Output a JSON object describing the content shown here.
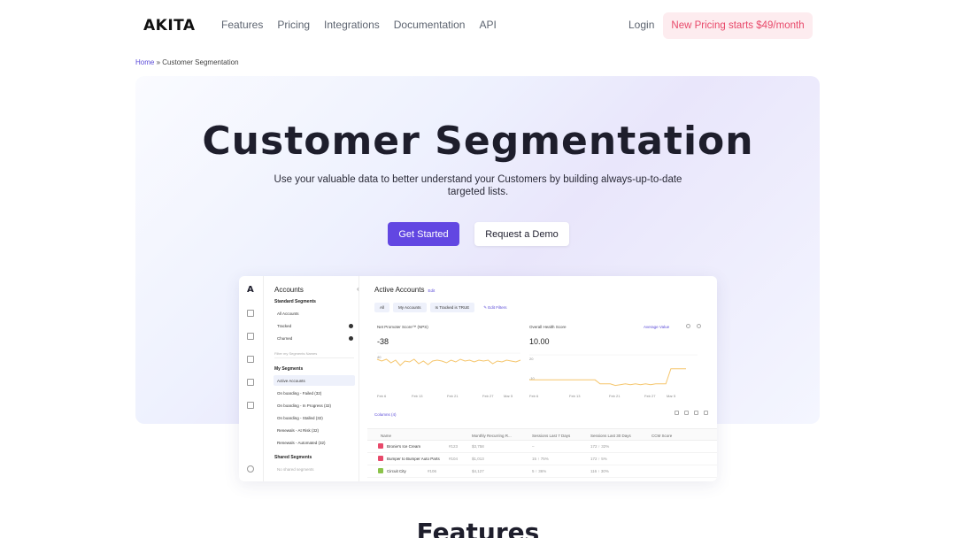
{
  "nav": {
    "logo": "AKITA",
    "links": [
      "Features",
      "Pricing",
      "Integrations",
      "Documentation",
      "API"
    ],
    "login": "Login",
    "promo": "New Pricing starts $49/month"
  },
  "breadcrumb": {
    "home": "Home",
    "sep": "»",
    "current": "Customer Segmentation"
  },
  "hero": {
    "title": "Customer Segmentation",
    "subtitle": "Use your valuable data to better understand your Customers by building always-up-to-date targeted lists.",
    "primary": "Get Started",
    "secondary": "Request a Demo"
  },
  "app": {
    "rail_logo": "A",
    "segments": {
      "title": "Accounts",
      "standard_header": "Standard Segments",
      "standard": [
        "All Accounts",
        "Tracked",
        "Churned"
      ],
      "search_placeholder": "Filter my Segments Names",
      "my_header": "My Segments",
      "my": [
        "Active Accounts",
        "On boarding - Failed (32)",
        "On boarding - In Progress (32)",
        "On boarding - Stalled (32)",
        "Renewals - At Risk (32)",
        "Renewals - Automated (32)"
      ],
      "shared_header": "Shared Segments",
      "shared_empty": "No shared segments"
    },
    "main": {
      "title": "Active Accounts",
      "edit": "Edit",
      "filters": [
        "All",
        "My Accounts",
        "Is Tracked is TRUE"
      ],
      "edit_filters": "Edit Filters",
      "chart1": {
        "label": "Net Promoter Score™ (NPS)",
        "value": "-38",
        "tick": "40"
      },
      "chart2": {
        "label": "Overall Health Score",
        "value": "10.00",
        "avg": "Average Value",
        "tick_top": "20",
        "tick_mid": "-10"
      },
      "x_ticks": [
        "Feb 6",
        "Feb 13",
        "Feb 21",
        "Feb 27",
        "Mar 5"
      ],
      "x_ticks2": [
        "Feb 6",
        "Feb 13",
        "Feb 21",
        "Feb 27",
        "Mar 5"
      ],
      "columns_link": "Columns (4)",
      "columns": [
        "Name",
        "Monthly Recurring R...",
        "Sessions Last 7 Days",
        "Sessions Last 30 Days",
        "CCM Score"
      ],
      "rows": [
        {
          "name": "Bronie's Ice Cream",
          "tag": "#123",
          "mrr": "$3,758",
          "s7": "–",
          "s30": "172 ↑ 32%",
          "color": "#e8496a"
        },
        {
          "name": "Bumper to Bumper Auto Parts",
          "tag": "#104",
          "mrr": "$1,013",
          "s7": "15 ↑ 75%",
          "s30": "172 ↑ 5%",
          "color": "#e8496a"
        },
        {
          "name": "Circuit City",
          "tag": "#106",
          "mrr": "$4,127",
          "s7": "5 ↑ 36%",
          "s30": "116 ↑ 30%",
          "color": "#8bc34a"
        }
      ]
    }
  },
  "features": {
    "title": "Features"
  },
  "chart_data": {
    "type": "line",
    "series": [
      {
        "values": [
          35,
          33,
          35,
          31,
          34,
          28,
          33,
          32,
          35,
          30,
          33,
          29,
          33,
          34,
          33,
          31,
          34,
          32,
          35,
          33,
          34,
          32,
          34,
          33,
          34,
          30,
          33,
          32,
          34,
          33,
          32,
          34
        ]
      },
      {
        "values": [
          -7,
          -7,
          -7,
          -7,
          -7,
          -7,
          -7,
          -7,
          -7,
          -7,
          -7,
          -7,
          -7,
          -7,
          -12,
          -12,
          -12,
          -14,
          -13,
          -12,
          -13,
          -12,
          -13,
          -12,
          -13,
          -12,
          -12,
          -12,
          7,
          7,
          7,
          7
        ]
      }
    ]
  }
}
